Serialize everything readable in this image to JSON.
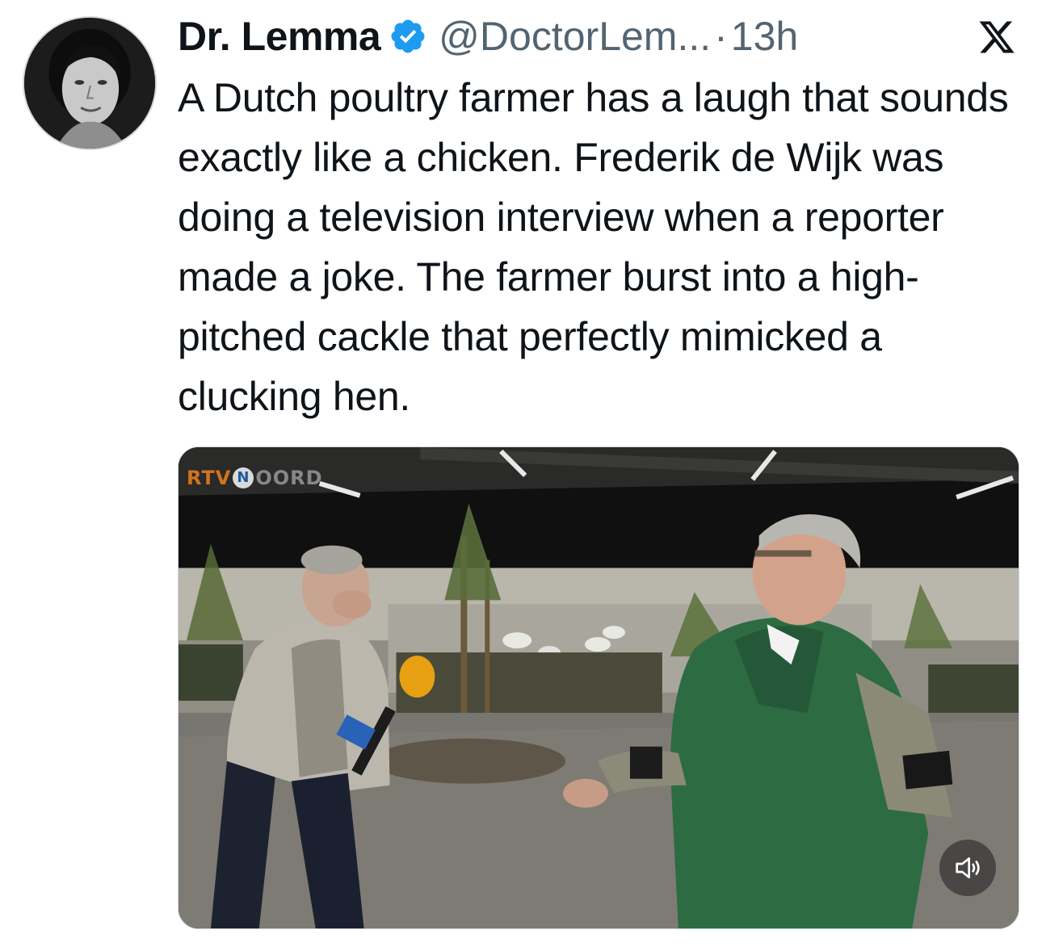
{
  "author": {
    "display_name": "Dr. Lemma",
    "handle": "@DoctorLem...",
    "separator": "·",
    "timestamp": "13h",
    "verified": true
  },
  "icons": {
    "verified": "verified-badge-icon",
    "platform": "x-logo-icon",
    "volume": "speaker-icon"
  },
  "colors": {
    "verified_badge": "#1d9bf0",
    "secondary_text": "#536471",
    "primary_text": "#0f1419"
  },
  "tweet": {
    "text": "A Dutch poultry farmer has a laugh that sounds exactly like a chicken. Frederik de Wijk was doing a television interview when a reporter made a joke. The farmer burst into a high-pitched cackle that perfectly mimicked a clucking hen."
  },
  "media": {
    "type": "video",
    "channel_logo": {
      "prefix": "RTV",
      "circle_letter": "N",
      "suffix": "OORD"
    }
  }
}
